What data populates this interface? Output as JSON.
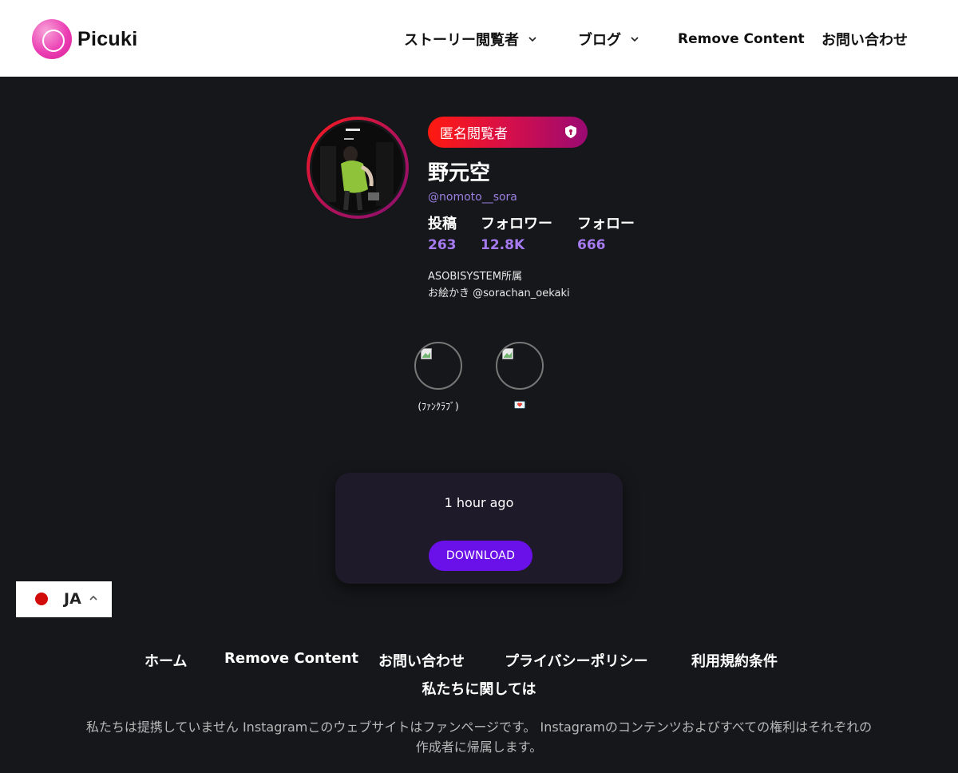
{
  "header": {
    "logo_text": "Picuki",
    "nav": [
      {
        "label": "ストーリー閲覧者",
        "has_dropdown": true
      },
      {
        "label": "ブログ",
        "has_dropdown": true
      },
      {
        "label": "Remove Content",
        "has_dropdown": false
      },
      {
        "label": "お問い合わせ",
        "has_dropdown": false
      }
    ]
  },
  "profile": {
    "badge": {
      "label": "匿名閲覧者",
      "icon": "shield-lock-icon"
    },
    "name": "野元空",
    "handle": "@nomoto__sora",
    "stats": [
      {
        "label": "投稿",
        "value": "263"
      },
      {
        "label": "フォロワー",
        "value": "12.8K"
      },
      {
        "label": "フォロー",
        "value": "666"
      }
    ],
    "bio": [
      "ASOBISYSTEM所属",
      "お絵かき @sorachan_oekaki"
    ]
  },
  "highlights": [
    {
      "label": "(ﾌｧﾝｸﾗﾌﾞ)"
    },
    {
      "label": "💌"
    }
  ],
  "post": {
    "time": "1 hour ago",
    "download_label": "DOWNLOAD"
  },
  "language": {
    "code": "JA"
  },
  "footer": {
    "links": [
      "ホーム",
      "Remove Content",
      "お問い合わせ",
      "プライバシーポリシー",
      "利用規約条件"
    ],
    "about": "私たちに関しては",
    "disclaimer": "私たちは提携していません Instagramこのウェブサイトはファンページです。 Instagramのコンテンツおよびすべての権利はそれぞれの作成者に帰属します。"
  },
  "colors": {
    "accent_purple": "#6a10e8",
    "stat_purple": "#a67bf2",
    "badge_gradient_start": "#ff1a0f",
    "badge_gradient_end": "#9a0a72",
    "logo_pink": "#ec3fb4"
  }
}
